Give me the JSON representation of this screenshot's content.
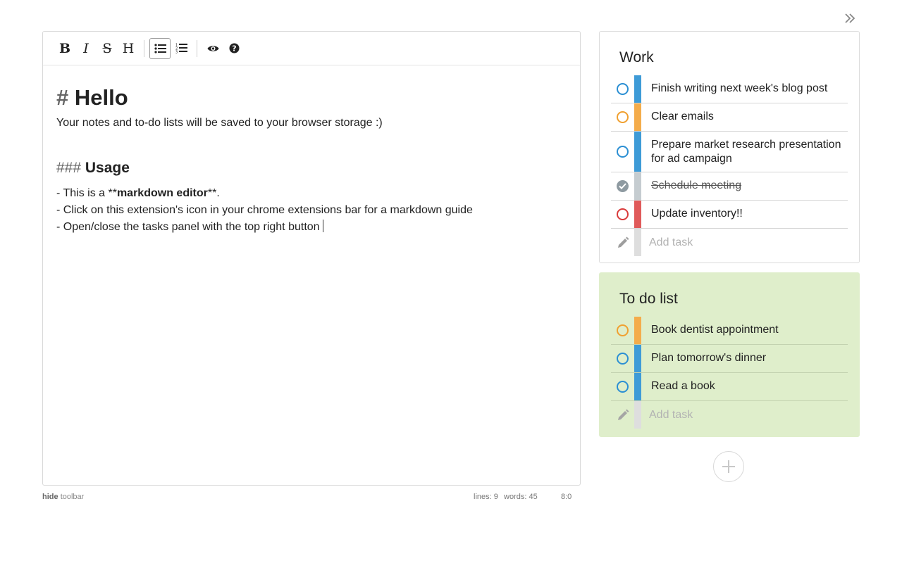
{
  "colors": {
    "blue": "#3e9bd7",
    "orange": "#f4ac4b",
    "red": "#e05a5a",
    "gray": "#c5ccd0",
    "add_bar": "#dedede"
  },
  "toolbar": {
    "bold_label": "B",
    "italic_label": "I",
    "strike_label": "S",
    "heading_label": "H"
  },
  "editor": {
    "h1_mark": "#",
    "h1_text": "Hello",
    "intro": "Your notes and to-do lists will be saved to your browser storage :)",
    "h3_mark": "###",
    "h3_text": "Usage",
    "line1_prefix": "- This is a **",
    "line1_bold": "markdown editor",
    "line1_suffix": "**.",
    "line2": "- Click on this extension's icon in your chrome extensions bar for a markdown guide",
    "line3": "- Open/close the tasks panel with the top right button"
  },
  "status": {
    "hide_label": "hide",
    "toolbar_label": "toolbar",
    "lines": "lines: 9",
    "words": "words: 45",
    "cursor": "8:0"
  },
  "lists": [
    {
      "title": "Work",
      "tasks": [
        {
          "text": "Finish writing next week's blog post",
          "color": "blue",
          "done": false
        },
        {
          "text": "Clear emails",
          "color": "orange",
          "done": false
        },
        {
          "text": "Prepare market research presentation for ad campaign",
          "color": "blue",
          "done": false
        },
        {
          "text": "Schedule meeting",
          "color": "gray",
          "done": true
        },
        {
          "text": "Update inventory!!",
          "color": "red",
          "done": false
        }
      ],
      "add_placeholder": "Add task"
    },
    {
      "title": "To do list",
      "tasks": [
        {
          "text": "Book dentist appointment",
          "color": "orange",
          "done": false
        },
        {
          "text": "Plan tomorrow's dinner",
          "color": "blue",
          "done": false
        },
        {
          "text": "Read a book",
          "color": "blue",
          "done": false
        }
      ],
      "add_placeholder": "Add task"
    }
  ]
}
